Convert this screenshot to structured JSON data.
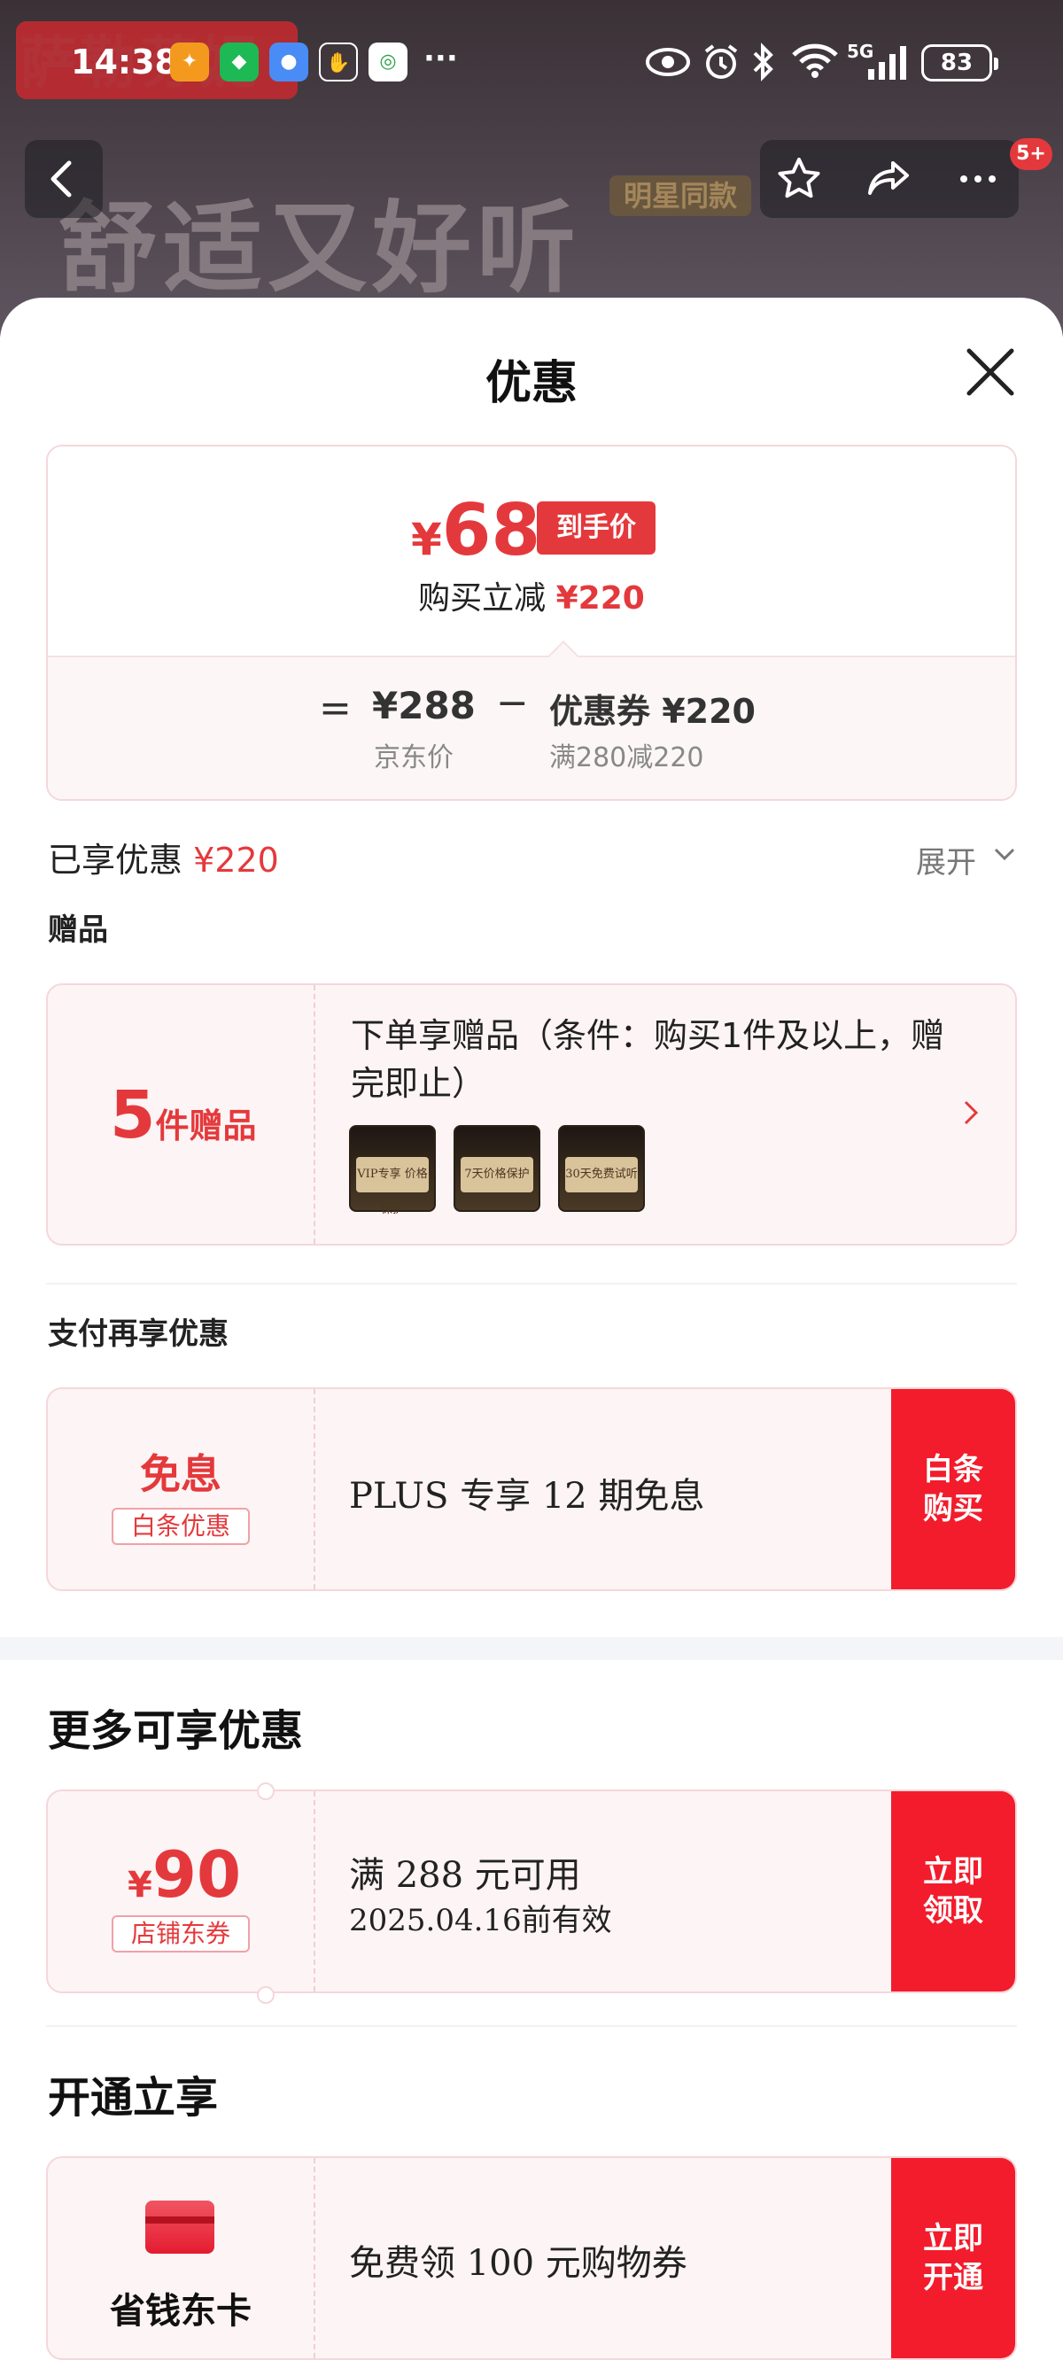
{
  "status_bar": {
    "time": "14:38",
    "fiveg": "5G",
    "battery": "83"
  },
  "background": {
    "ghost_title": "萨勒芬妮",
    "slogan": "舒适又好听",
    "tag": "明星同款",
    "cart_badge": "5+"
  },
  "sheet": {
    "title": "优惠",
    "price_box": {
      "currency": "¥",
      "final_price": "68",
      "final_tag": "到手价",
      "reduce_label": "购买立减",
      "reduce_amount": "¥220",
      "equals": "=",
      "jd_price": "¥288",
      "jd_price_label": "京东价",
      "minus": "−",
      "coupon_price": "优惠券 ¥220",
      "coupon_condition": "满280减220"
    },
    "enjoyed": {
      "label": "已享优惠",
      "amount": "¥220",
      "expand": "展开"
    },
    "gifts": {
      "section_title": "赠品",
      "count": "5",
      "count_unit": "件赠品",
      "description": "下单享赠品（条件：购买1件及以上，赠完即止）",
      "thumbs": [
        "VIP专享 价格保护",
        "7天价格保护",
        "30天免费试听"
      ]
    },
    "payment": {
      "section_title": "支付再享优惠",
      "big": "免息",
      "tag": "白条优惠",
      "text": "PLUS 专享 12 期免息",
      "button": "白条 购买"
    },
    "more": {
      "section_title": "更多可享优惠",
      "currency": "¥",
      "value": "90",
      "tag": "店铺东券",
      "line1": "满 288 元可用",
      "line2": "2025.04.16前有效",
      "button": "立即 领取"
    },
    "open": {
      "section_title": "开通立享",
      "card_name": "省钱东卡",
      "text": "免费领 100 元购物券",
      "button": "立即 开通"
    }
  },
  "colors": {
    "accent": "#e4393c",
    "button_red": "#f21c2c"
  }
}
